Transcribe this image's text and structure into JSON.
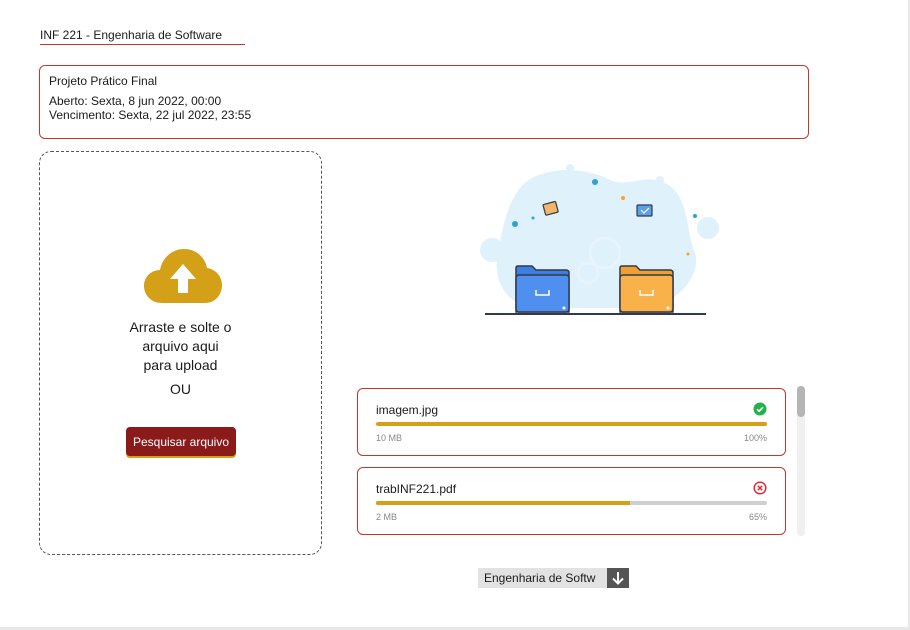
{
  "course": {
    "title": "INF 221 - Engenharia de Software"
  },
  "assignment": {
    "name": "Projeto Prático Final",
    "opened": "Aberto: Sexta, 8 jun 2022, 00:00",
    "due": "Vencimento: Sexta, 22 jul 2022, 23:55"
  },
  "dropzone": {
    "icon": "cloud-upload-icon",
    "instruction": "Arraste e solte o\narquivo aqui\npara upload",
    "or_label": "OU",
    "browse_label": "Pesquisar arquivo"
  },
  "files": [
    {
      "name": "imagem.jpg",
      "size": "10 MB",
      "progress_label": "100%",
      "progress": 1.0,
      "status": "success",
      "status_icon": "check-circle-icon",
      "status_color": "#22b14c"
    },
    {
      "name": "trabINF221.pdf",
      "size": "2 MB",
      "progress_label": "65%",
      "progress": 0.65,
      "status": "error",
      "status_icon": "x-circle-icon",
      "status_color": "#e0242b"
    }
  ],
  "course_select": {
    "value": "Engenharia de Softw"
  },
  "colors": {
    "accent": "#8b1a1a",
    "border": "#c0392b",
    "progress": "#d4a017",
    "cloud": "#d4a017"
  }
}
